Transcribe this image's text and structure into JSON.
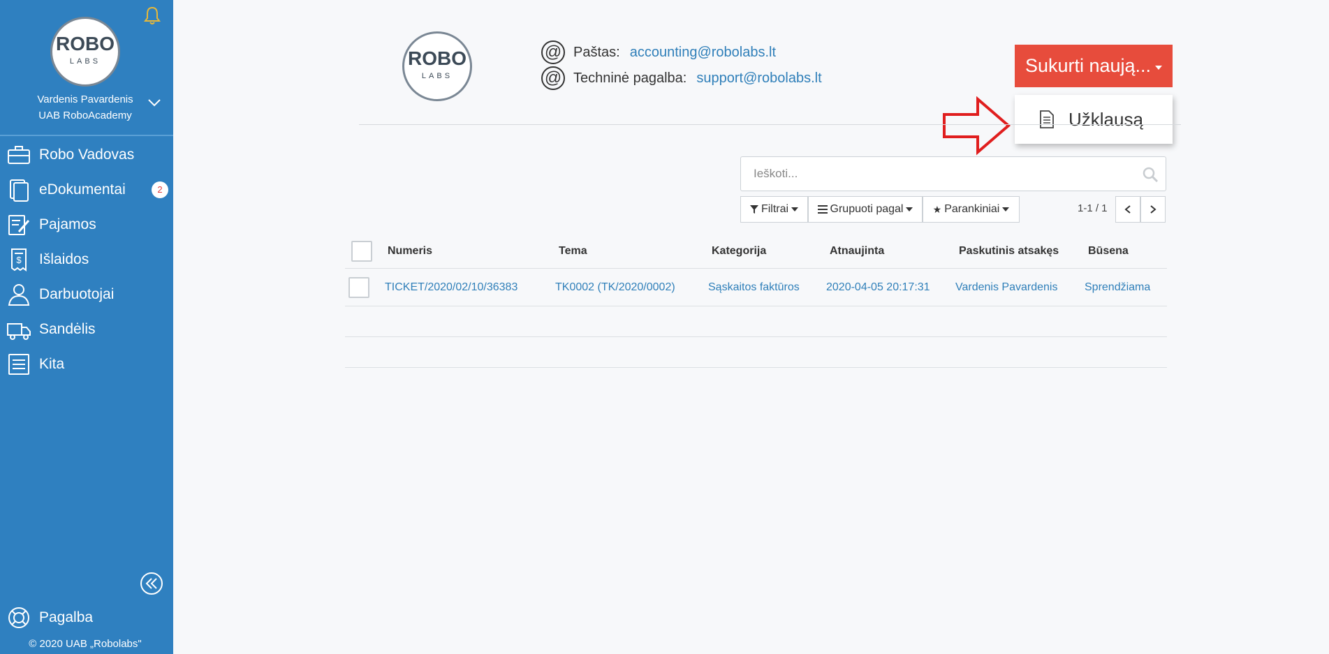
{
  "sidebar": {
    "user_name": "Vardenis Pavardenis",
    "company": "UAB RoboAcademy",
    "logo_text": "ROBO",
    "logo_sub": "LABS",
    "items": [
      {
        "label": "Robo Vadovas",
        "icon": "briefcase-icon"
      },
      {
        "label": "eDokumentai",
        "icon": "documents-icon",
        "badge": "2"
      },
      {
        "label": "Pajamos",
        "icon": "edit-document-icon"
      },
      {
        "label": "Išlaidos",
        "icon": "receipt-icon"
      },
      {
        "label": "Darbuotojai",
        "icon": "person-icon"
      },
      {
        "label": "Sandėlis",
        "icon": "truck-icon"
      },
      {
        "label": "Kita",
        "icon": "list-icon"
      }
    ],
    "help_label": "Pagalba",
    "copyright": "© 2020 UAB „Robolabs\""
  },
  "header": {
    "logo_text": "ROBO",
    "logo_sub": "LABS",
    "email_label": "Paštas:",
    "email_value": "accounting@robolabs.lt",
    "support_label": "Techninė pagalba:",
    "support_value": "support@robolabs.lt",
    "create_button": "Sukurti naują...",
    "dropdown_item": "Užklausą"
  },
  "toolbar": {
    "search_placeholder": "Ieškoti...",
    "filters": "Filtrai",
    "group_by": "Grupuoti pagal",
    "favorites": "Parankiniai",
    "pager": "1-1 / 1"
  },
  "table": {
    "columns": [
      "Numeris",
      "Tema",
      "Kategorija",
      "Atnaujinta",
      "Paskutinis atsakęs",
      "Būsena"
    ],
    "rows": [
      [
        "TICKET/2020/02/10/36383",
        "TK0002 (TK/2020/0002)",
        "Sąskaitos faktūros",
        "2020-04-05 20:17:31",
        "Vardenis Pavardenis",
        "Sprendžiama"
      ]
    ]
  },
  "colors": {
    "sidebar": "#2f80c0",
    "accent_red": "#e74c3c",
    "link": "#2f7fb9",
    "bell": "#e8b838"
  }
}
